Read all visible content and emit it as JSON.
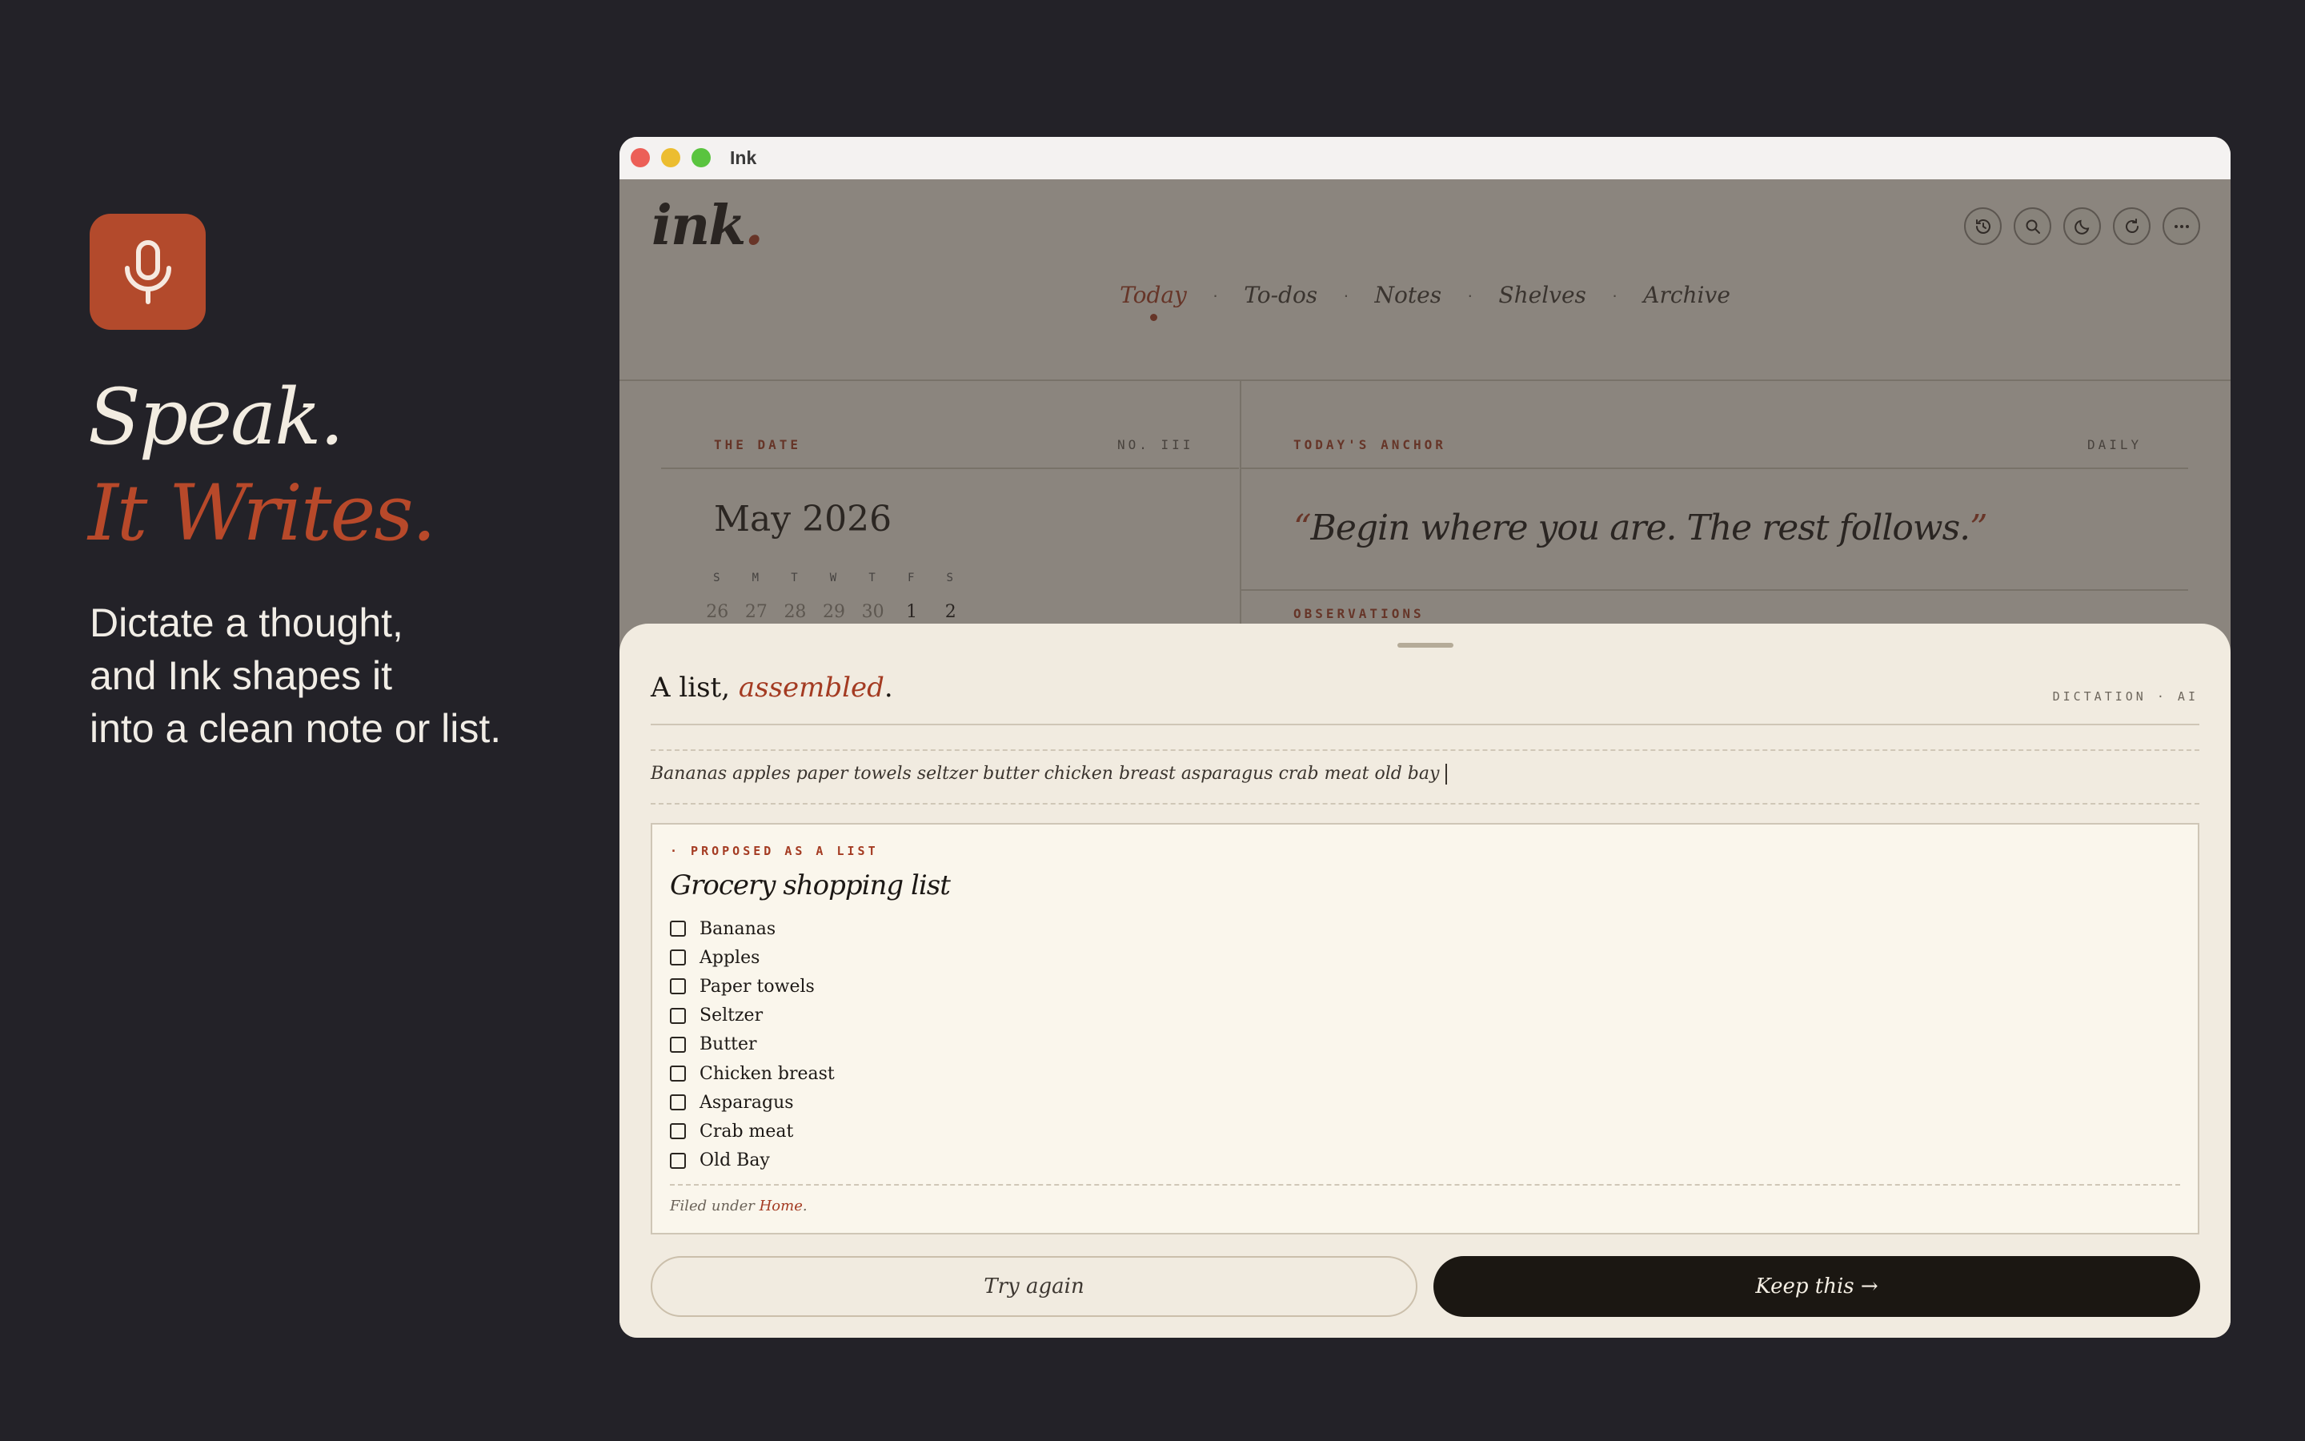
{
  "promo": {
    "icon": "microphone-icon",
    "headline_line1": "Speak.",
    "headline_line2": "It Writes.",
    "tagline": [
      "Dictate a thought,",
      "and Ink shapes it",
      "into a clean note or list."
    ]
  },
  "window": {
    "title": "Ink"
  },
  "app": {
    "logo_text": "ink",
    "logo_dot": ".",
    "toolbar_icons": [
      "history-icon",
      "search-icon",
      "moon-icon",
      "refresh-icon",
      "more-icon"
    ],
    "nav": {
      "items": [
        "Today",
        "To-dos",
        "Notes",
        "Shelves",
        "Archive"
      ],
      "separator": "·",
      "active": "Today"
    },
    "date_panel": {
      "label": "THE DATE",
      "number": "NO. III",
      "month": "May 2026",
      "weekdays": [
        "S",
        "M",
        "T",
        "W",
        "T",
        "F",
        "S"
      ],
      "first_row": [
        "26",
        "27",
        "28",
        "29",
        "30",
        "1",
        "2"
      ]
    },
    "anchor_panel": {
      "label": "TODAY'S ANCHOR",
      "frequency": "DAILY",
      "quote_open": "“",
      "quote_text": "Begin where you are. The rest follows.",
      "quote_close": "”",
      "observations_label": "OBSERVATIONS"
    }
  },
  "sheet": {
    "title_plain": "A list, ",
    "title_accent": "assembled",
    "title_end": ".",
    "tag": "DICTATION · AI",
    "transcript": "Bananas apples paper towels seltzer butter chicken breast asparagus crab meat old bay",
    "proposal": {
      "label": "· PROPOSED AS A LIST",
      "title": "Grocery shopping list",
      "items": [
        "Bananas",
        "Apples",
        "Paper towels",
        "Seltzer",
        "Butter",
        "Chicken breast",
        "Asparagus",
        "Crab meat",
        "Old Bay"
      ],
      "filed_prefix": "Filed under ",
      "filed_category": "Home",
      "filed_suffix": "."
    },
    "try_again_label": "Try again",
    "keep_label": "Keep this →"
  },
  "colors": {
    "background": "#232228",
    "accent": "#b34a2c",
    "paper": "#f1ebe0",
    "ink": "#1b1712"
  }
}
